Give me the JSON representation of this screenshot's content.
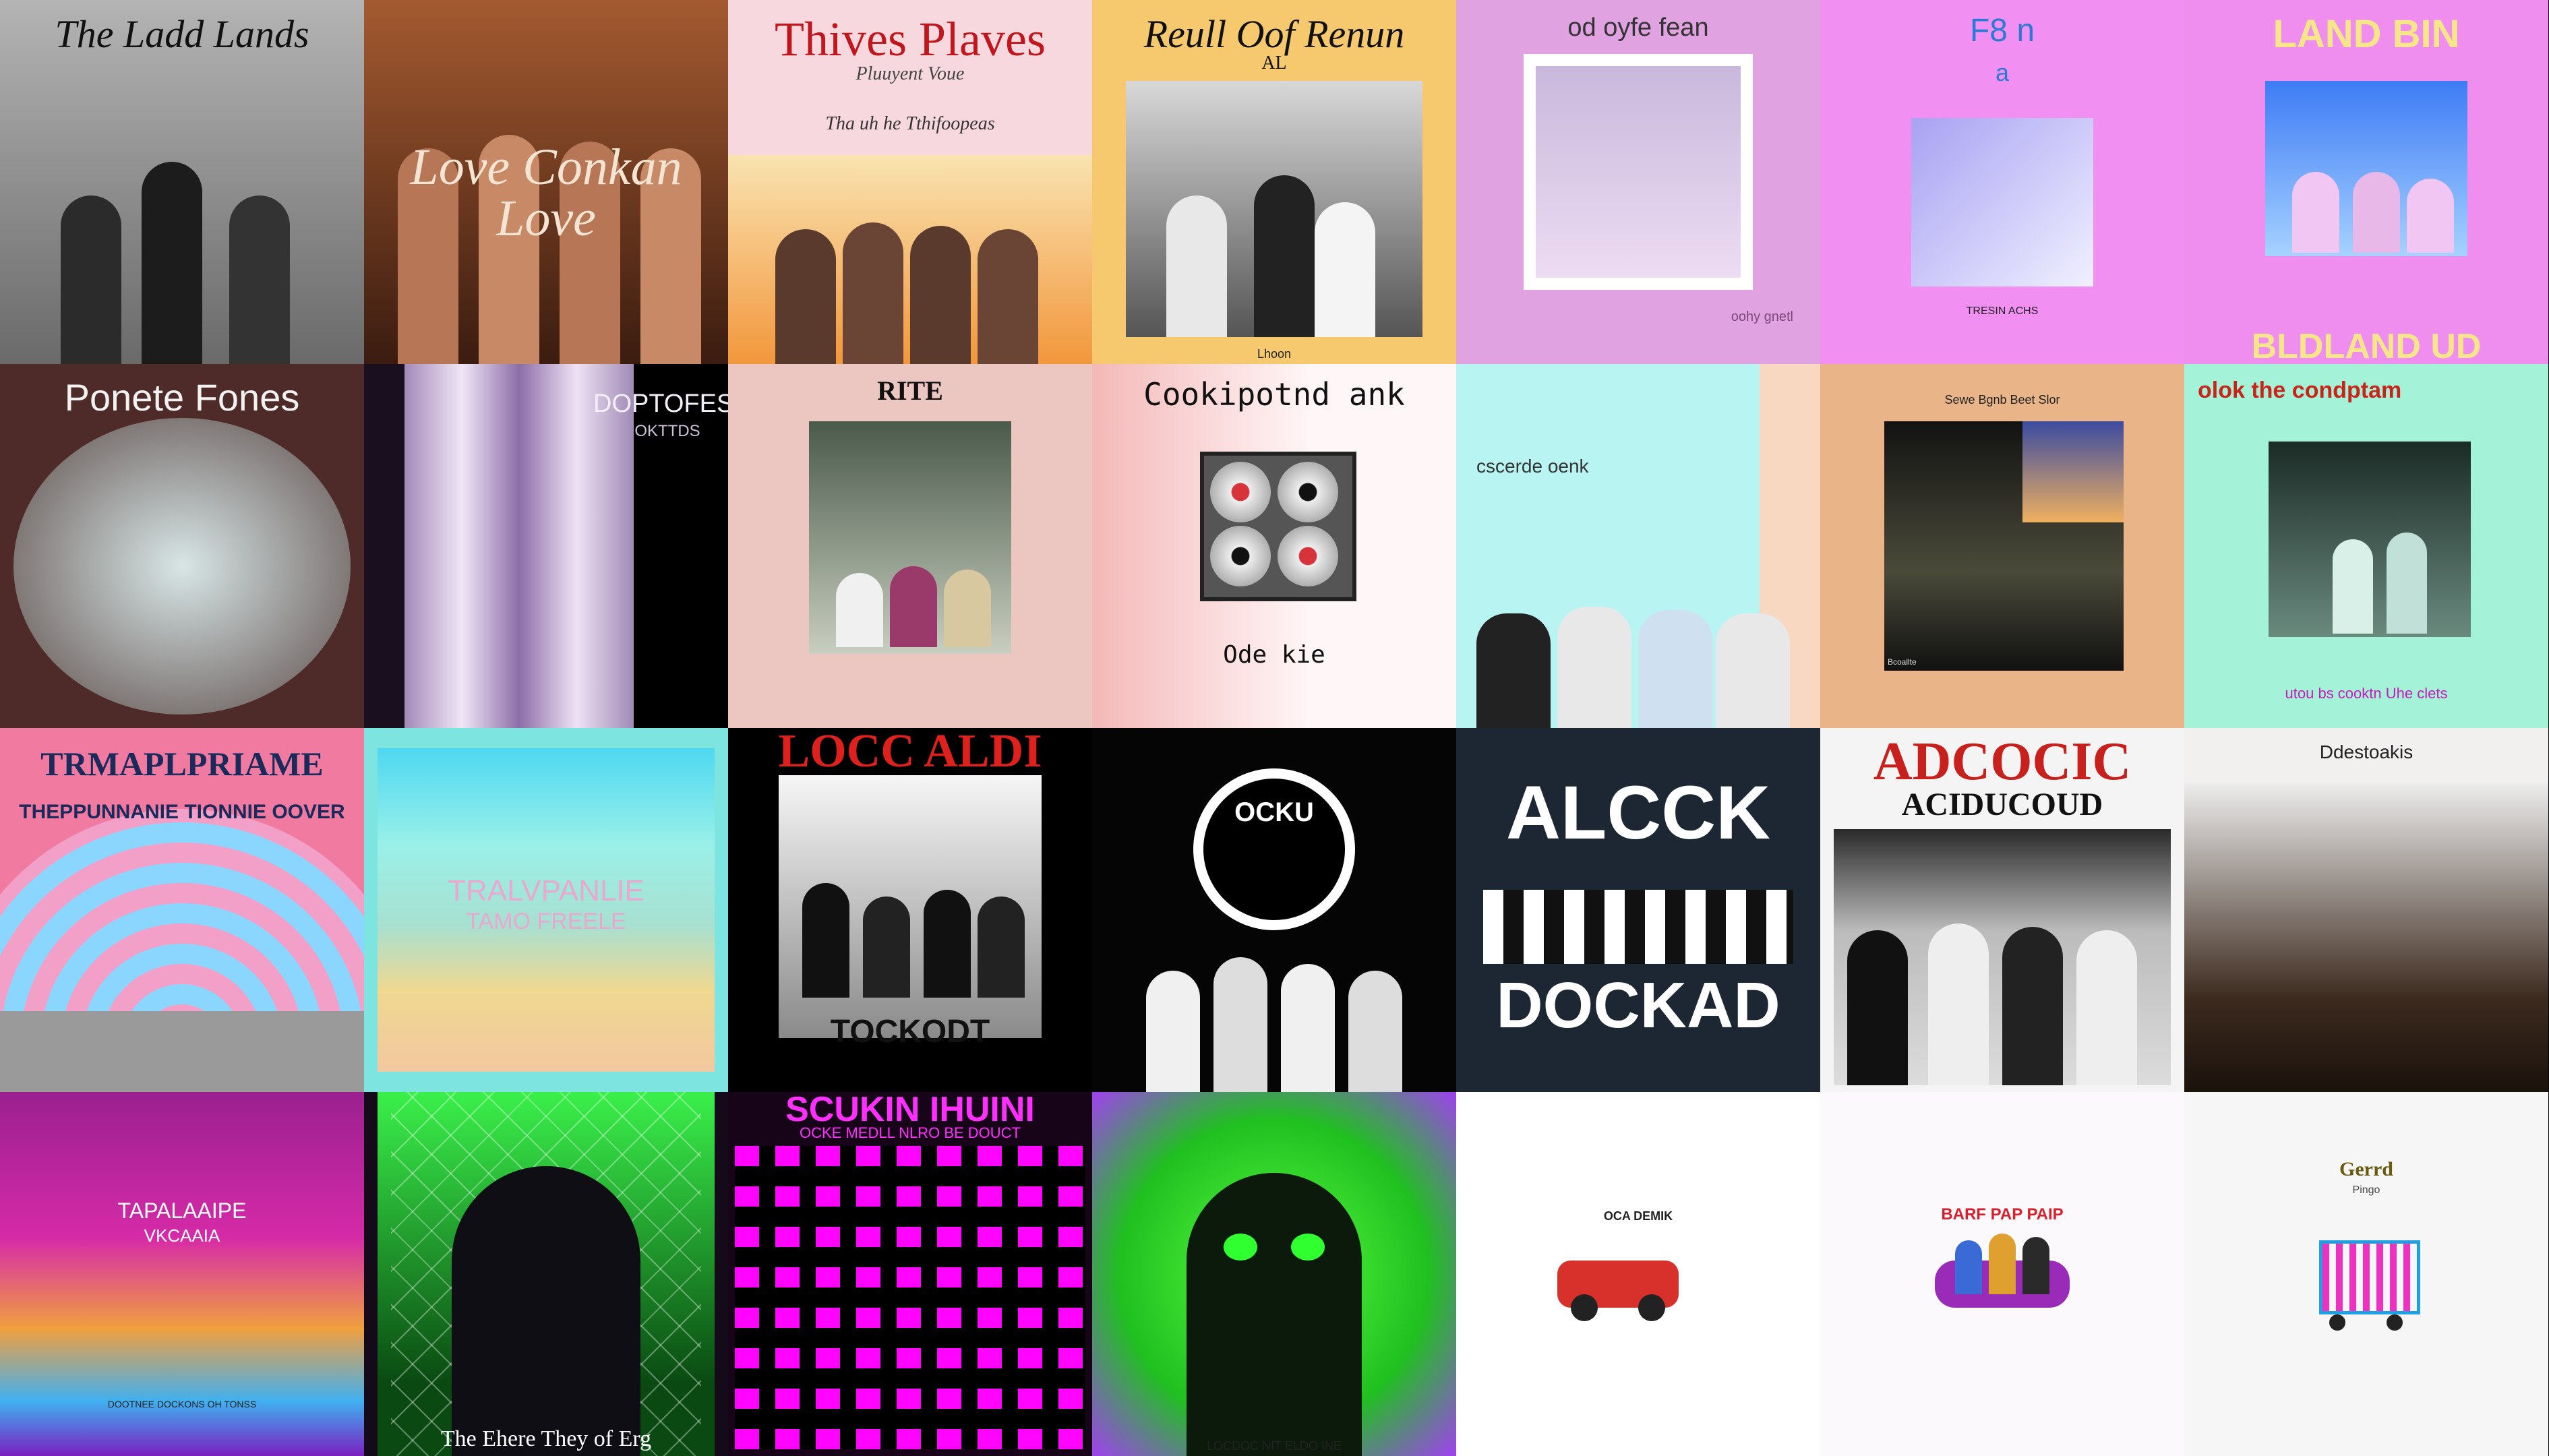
{
  "covers": [
    {
      "title": "The Ladd Lands",
      "subtitle": "",
      "bottom": ""
    },
    {
      "title": "Love Conkan Love",
      "subtitle": "",
      "bottom": ""
    },
    {
      "title": "Thives Plaves",
      "subtitle": "Pluuyent Voue",
      "bottom": "Tha uh he Tthifoopeas"
    },
    {
      "title": "Reull Oof Renun",
      "subtitle": "AL",
      "bottom": "Lhoon"
    },
    {
      "title": "od oyfe fean",
      "subtitle": "",
      "bottom": "oohy gnetl"
    },
    {
      "title": "F8 n",
      "subtitle": "a",
      "bottom": "TRESIN ACHS"
    },
    {
      "title": "LAND BIN",
      "subtitle": "",
      "bottom": "BLDLAND UD"
    },
    {
      "title": "Ponete Fones",
      "subtitle": "",
      "bottom": ""
    },
    {
      "title": "DOPTOFES",
      "subtitle": "OKTTDS",
      "bottom": ""
    },
    {
      "title": "RITE",
      "subtitle": "",
      "bottom": ""
    },
    {
      "title": "Cookipotnd ank",
      "subtitle": "",
      "bottom": "Ode kie"
    },
    {
      "title": "cscerde oenk",
      "subtitle": "",
      "bottom": ""
    },
    {
      "title": "Sewe Bgnb Beet Slor",
      "subtitle": "",
      "bottom": "Bcoallte"
    },
    {
      "title": "olok       the condptam",
      "subtitle": "",
      "bottom": "utou bs cooktn Uhe clets"
    },
    {
      "title": "TRMAPLPRIAME",
      "subtitle": "THEPPUNNANIE  TIONNIE OOVER",
      "bottom": ""
    },
    {
      "title": "TRALVPANLIE",
      "subtitle": "TAMO  FREELE",
      "bottom": ""
    },
    {
      "title": "LOCC ALDI",
      "subtitle": "",
      "bottom": "TOCKODT"
    },
    {
      "title": "OCKU",
      "subtitle": "",
      "bottom": ""
    },
    {
      "title": "ALCCK",
      "subtitle": "",
      "bottom": "DOCKAD"
    },
    {
      "title": "ADCOCIC",
      "subtitle": "ACIDUCOUD",
      "bottom": ""
    },
    {
      "title": "Ddestoakis",
      "subtitle": "",
      "bottom": ""
    },
    {
      "title": "TAPALAAIPE",
      "subtitle": "VKCAAIA",
      "bottom": "DOOTNEE DOCKONS OH TONSS"
    },
    {
      "title": "",
      "subtitle": "",
      "bottom": "The Ehere They of Erg"
    },
    {
      "title": "SCUKIN IHUINI",
      "subtitle": "OCKE MEDLL NLRO BE DOUCT",
      "bottom": ""
    },
    {
      "title": "",
      "subtitle": "",
      "bottom": "LOCDOC NIT ELDO INE"
    },
    {
      "title": "OCA DEMIK",
      "subtitle": "",
      "bottom": ""
    },
    {
      "title": "BARF PAP PAIP",
      "subtitle": "",
      "bottom": ""
    },
    {
      "title": "Gerrd",
      "subtitle": "Pingo",
      "bottom": ""
    }
  ],
  "colors": {
    "c0": "#9d9d9d",
    "c1": "#7a3c22",
    "c2": "#f7d8de",
    "c3": "#f6c96e",
    "c4": "#e0a2e0",
    "c5": "#f28ff2",
    "c6": "#f08ef0",
    "c7": "#4e2a28",
    "c8": "#1a0f1e",
    "c9": "#ecc7c2",
    "c10": "#fff6f7",
    "c11": "#b8f4f2",
    "c12": "#e8b488",
    "c13": "#a4f2d8",
    "c14": "#f07aa0",
    "c15": "#7ee4e0",
    "c16": "#000000",
    "c17": "#050505",
    "c18": "#1d2733",
    "c19": "#f4f4f4",
    "c20": "#f1f0ee",
    "c21": "#8a1a8a",
    "c22": "#140a1a",
    "c23": "#180418",
    "c24": "#20ff30",
    "c25": "#ffffff",
    "c26": "#fbf9fb",
    "c27": "#f5f6f5"
  }
}
